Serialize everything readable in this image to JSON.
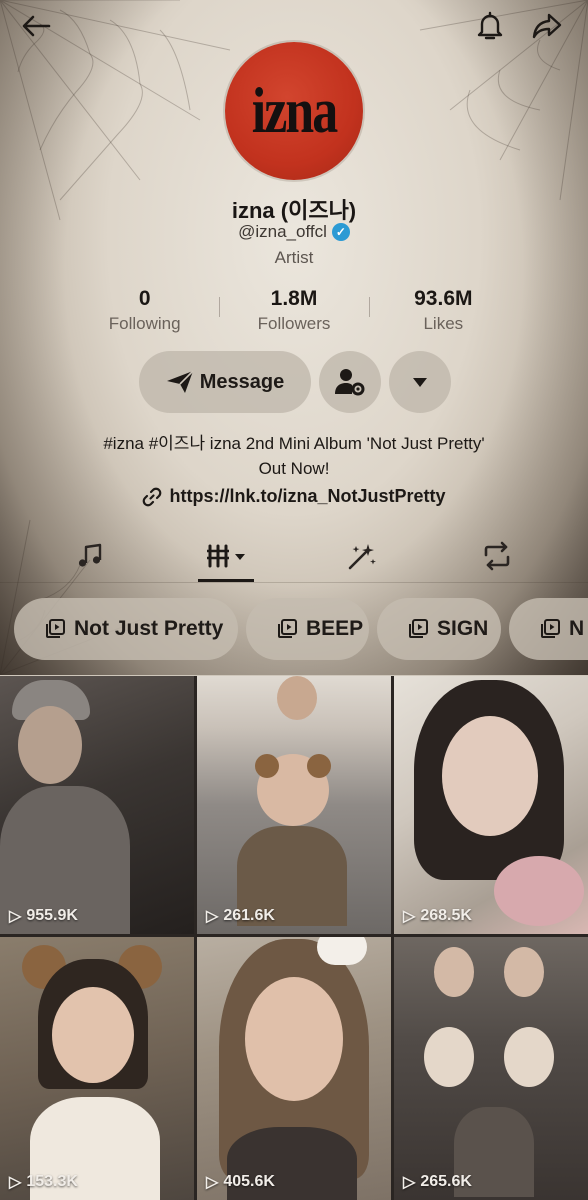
{
  "profile": {
    "avatar_text": "izna",
    "name": "izna (이즈나)",
    "handle": "@izna_offcl",
    "category": "Artist"
  },
  "stats": [
    {
      "value": "0",
      "label": "Following"
    },
    {
      "value": "1.8M",
      "label": "Followers"
    },
    {
      "value": "93.6M",
      "label": "Likes"
    }
  ],
  "actions": {
    "message_label": "Message"
  },
  "bio": {
    "line1": "#izna #이즈나 izna 2nd Mini Album 'Not Just Pretty'",
    "line2": "Out Now!",
    "link": "https://lnk.to/izna_NotJustPretty"
  },
  "playlists": [
    "Not Just Pretty",
    "BEEP",
    "SIGN",
    "N"
  ],
  "videos": [
    {
      "views": "955.9K"
    },
    {
      "views": "261.6K"
    },
    {
      "views": "268.5K"
    },
    {
      "views": "153.3K"
    },
    {
      "views": "405.6K"
    },
    {
      "views": "265.6K"
    }
  ],
  "colors": {
    "avatar_red": "#c2321e",
    "verified_blue": "#2b9ad4",
    "paper": "#d8d0c4"
  },
  "icons": [
    "back-arrow-icon",
    "bell-icon",
    "share-icon",
    "send-icon",
    "person-settings-icon",
    "caret-down-icon",
    "link-icon",
    "music-note-icon",
    "video-grid-icon",
    "sparkle-icon",
    "repost-icon",
    "playlist-icon",
    "play-icon"
  ]
}
